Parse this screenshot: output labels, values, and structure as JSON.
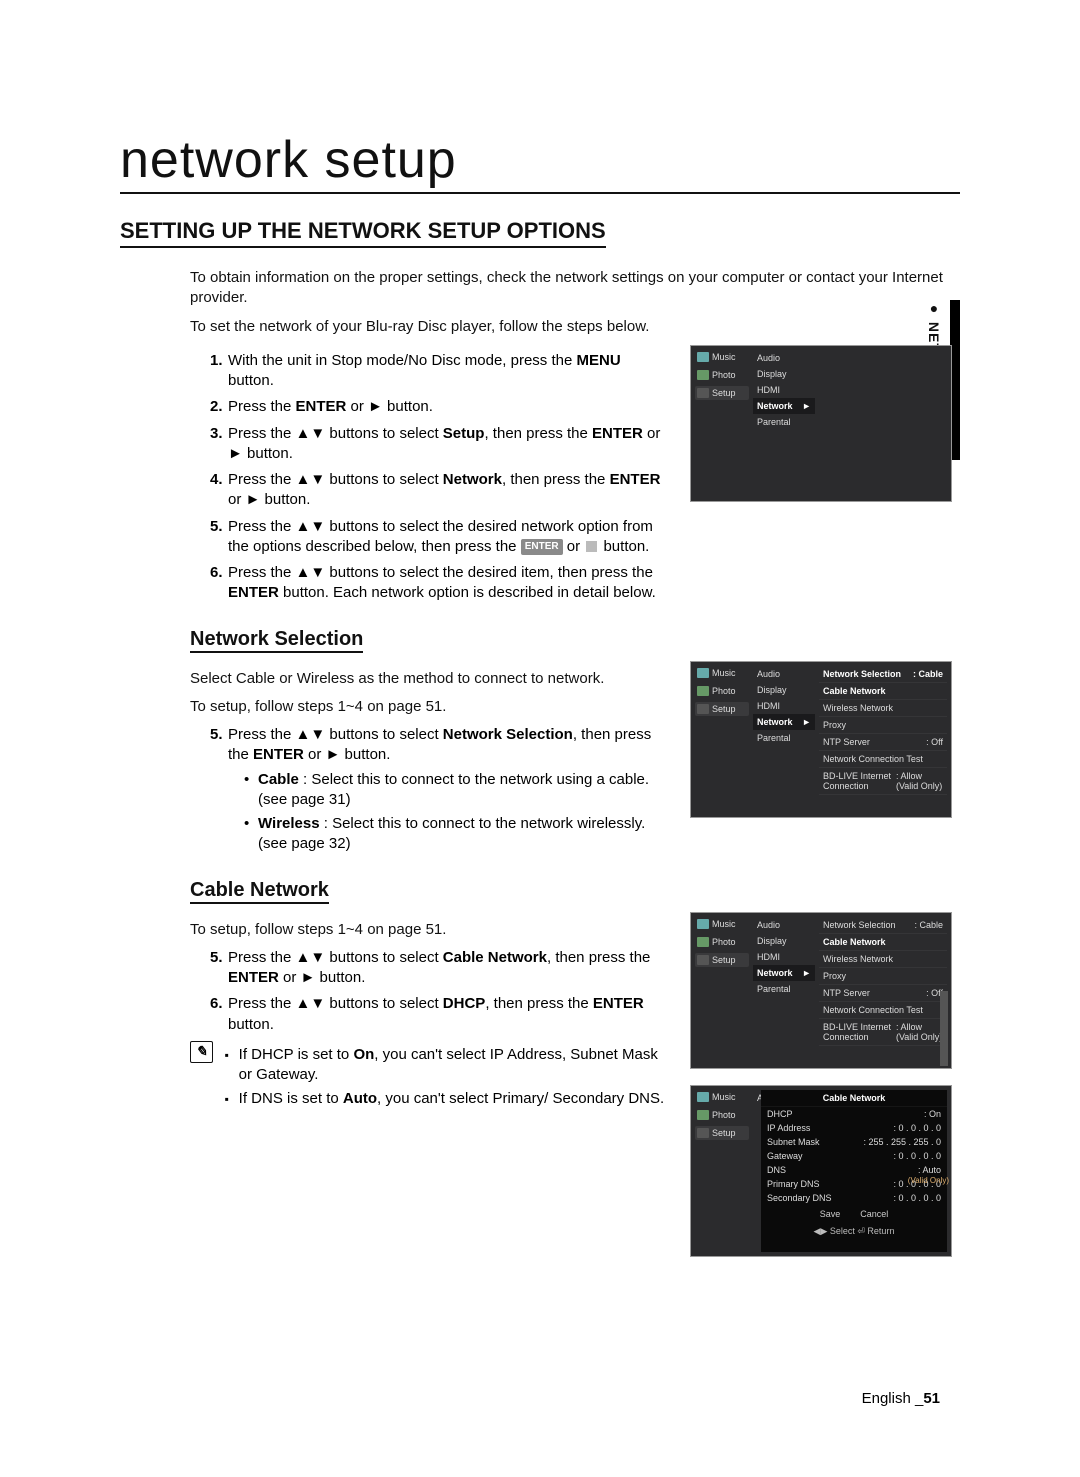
{
  "page_title": "network setup",
  "section_title": "SETTING UP THE NETWORK SETUP OPTIONS",
  "intro_1": "To obtain information on the proper settings, check the network settings on your computer or contact your Internet provider.",
  "intro_2": "To set the network of your Blu-ray Disc player, follow the steps below.",
  "steps_main": [
    {
      "pre": "With the unit in Stop mode/No Disc mode, press the ",
      "bold": "MENU",
      "post": " button."
    },
    {
      "pre": "Press the ",
      "bold": "ENTER",
      "post": " or ► button."
    },
    {
      "pre": "Press the ▲▼ buttons to select ",
      "bold": "Setup",
      "post_raw": ", then press the ",
      "bold2": "ENTER",
      "post2": " or ► button."
    },
    {
      "pre": "Press the ▲▼ buttons to select ",
      "bold": "Network",
      "post_raw": ", then press the ",
      "bold2": "ENTER",
      "post2": " or ► button."
    },
    {
      "full_a": "Press the ▲▼ buttons to select the desired network option from the options described below, then press the ",
      "badge": "ENTER",
      "full_b": " or ",
      "square": true,
      "full_c": " button."
    },
    {
      "pre": "Press the ▲▼ buttons to select the desired item, then press the ",
      "bold": "ENTER",
      "post_raw": " button. Each network option is described in detail below.",
      "nowrap": true
    }
  ],
  "netsel": {
    "title": "Network Selection",
    "p1": "Select Cable or Wireless as the method to connect to network.",
    "p2": "To setup, follow steps 1~4 on page 51.",
    "step5": {
      "pre": "Press the ▲▼ buttons to select ",
      "bold": "Network Selection",
      "post_raw": ", then press the ",
      "bold2": "ENTER",
      "post2": " or ► button."
    },
    "bullets": [
      {
        "lead": "Cable",
        "text": " : Select this to connect to the network using a cable. (see page 31)"
      },
      {
        "lead": "Wireless",
        "text": " : Select this to connect to the network wirelessly. (see page 32)"
      }
    ]
  },
  "cablent": {
    "title": "Cable Network",
    "p1": "To setup, follow steps 1~4 on page 51.",
    "step5": {
      "pre": "Press the ▲▼ buttons to select ",
      "bold": "Cable Network",
      "post_raw": ", then press the ",
      "bold2": "ENTER",
      "post2": " or ► button."
    },
    "step6": {
      "pre": "Press the ▲▼ buttons to select ",
      "bold": "DHCP",
      "post_raw": ", then press the ",
      "bold2": "ENTER",
      "post2": " button."
    },
    "notes": [
      {
        "a": "If DHCP is set to ",
        "b": "On",
        "c": ", you can't select IP Address, Subnet Mask or Gateway."
      },
      {
        "a": "If DNS is set to ",
        "b": "Auto",
        "c": ", you can't select Primary/ Secondary DNS."
      }
    ]
  },
  "side_label": "● NETWORK SETUP",
  "footer": {
    "lang": "English ",
    "sep": "_",
    "page": "51"
  },
  "osd": {
    "left_items": [
      "Music",
      "Photo",
      "Setup"
    ],
    "mid_items": [
      "Audio",
      "Display",
      "HDMI",
      "Network",
      "Parental"
    ],
    "mid_chev": "►",
    "shot1_right": [],
    "shot2_right": [
      {
        "k": "Network Selection",
        "v": ": Cable",
        "hdr": true
      },
      {
        "k": "Cable Network",
        "v": ""
      },
      {
        "k": "Wireless Network",
        "v": ""
      },
      {
        "k": "Proxy",
        "v": ""
      },
      {
        "k": "NTP Server",
        "v": ": Off"
      },
      {
        "k": "Network Connection Test",
        "v": ""
      },
      {
        "k": "BD-LIVE Internet Connection",
        "v": ": Allow (Valid Only)"
      }
    ],
    "shot3_right": [
      {
        "k": "Network Selection",
        "v": ": Cable"
      },
      {
        "k": "Cable Network",
        "v": "",
        "hdr": true
      },
      {
        "k": "Wireless Network",
        "v": ""
      },
      {
        "k": "Proxy",
        "v": ""
      },
      {
        "k": "NTP Server",
        "v": ": Off"
      },
      {
        "k": "Network Connection Test",
        "v": ""
      },
      {
        "k": "BD-LIVE Internet Connection",
        "v": ": Allow (Valid Only)"
      }
    ],
    "shot4": {
      "header": "Cable Network",
      "rows": [
        {
          "k": "DHCP",
          "v": ": On"
        },
        {
          "k": "IP Address",
          "v": ":   0 . 0 . 0 . 0"
        },
        {
          "k": "Subnet Mask",
          "v": ": 255 . 255 . 255 . 0"
        },
        {
          "k": "Gateway",
          "v": ":   0 . 0 . 0 . 0"
        },
        {
          "k": "DNS",
          "v": ": Auto"
        },
        {
          "k": "Primary DNS",
          "v": ":   0 . 0 . 0 . 0"
        },
        {
          "k": "Secondary DNS",
          "v": ":   0 . 0 . 0 . 0"
        }
      ],
      "btns": [
        "Save",
        "Cancel"
      ],
      "side": "(Valid Only)",
      "foot": "◀▶ Select     ⏎ Return"
    }
  }
}
